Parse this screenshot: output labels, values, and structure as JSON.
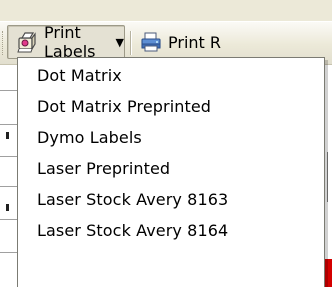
{
  "toolbar": {
    "buttons": [
      {
        "label": "Print Labels",
        "icon": "label-printer-icon",
        "has_dropdown": true,
        "pressed": true
      },
      {
        "label": "Print R",
        "icon": "printer-icon",
        "has_dropdown": false,
        "pressed": false
      }
    ]
  },
  "menu": {
    "items": [
      {
        "label": "Dot Matrix"
      },
      {
        "label": "Dot Matrix Preprinted"
      },
      {
        "label": "Dymo Labels"
      },
      {
        "label": "Laser Preprinted"
      },
      {
        "label": "Laser Stock Avery 8163"
      },
      {
        "label": "Laser Stock Avery 8164"
      }
    ]
  },
  "colors": {
    "toolbar_bg": "#ece9d8",
    "menu_bg": "#ffffff",
    "menu_border": "#7b7b73"
  }
}
